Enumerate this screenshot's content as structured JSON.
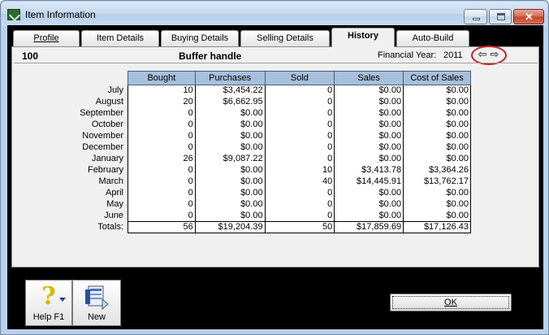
{
  "window": {
    "title": "Item Information"
  },
  "tabs": [
    {
      "label": "Profile"
    },
    {
      "label": "Item Details"
    },
    {
      "label": "Buying Details"
    },
    {
      "label": "Selling Details"
    },
    {
      "label": "History"
    },
    {
      "label": "Auto-Build"
    }
  ],
  "active_tab": "History",
  "item": {
    "number": "100",
    "name": "Buffer handle"
  },
  "financial_year": {
    "label": "Financial Year:",
    "value": "2011"
  },
  "history": {
    "columns": [
      "Bought",
      "Purchases",
      "Sold",
      "Sales",
      "Cost of Sales"
    ],
    "rows": [
      {
        "month": "July",
        "bought": "10",
        "purchases": "$3,454.22",
        "sold": "0",
        "sales": "$0.00",
        "cost": "$0.00"
      },
      {
        "month": "August",
        "bought": "20",
        "purchases": "$6,662.95",
        "sold": "0",
        "sales": "$0.00",
        "cost": "$0.00"
      },
      {
        "month": "September",
        "bought": "0",
        "purchases": "$0.00",
        "sold": "0",
        "sales": "$0.00",
        "cost": "$0.00"
      },
      {
        "month": "October",
        "bought": "0",
        "purchases": "$0.00",
        "sold": "0",
        "sales": "$0.00",
        "cost": "$0.00"
      },
      {
        "month": "November",
        "bought": "0",
        "purchases": "$0.00",
        "sold": "0",
        "sales": "$0.00",
        "cost": "$0.00"
      },
      {
        "month": "December",
        "bought": "0",
        "purchases": "$0.00",
        "sold": "0",
        "sales": "$0.00",
        "cost": "$0.00"
      },
      {
        "month": "January",
        "bought": "26",
        "purchases": "$9,087.22",
        "sold": "0",
        "sales": "$0.00",
        "cost": "$0.00"
      },
      {
        "month": "February",
        "bought": "0",
        "purchases": "$0.00",
        "sold": "10",
        "sales": "$3,413.78",
        "cost": "$3,364.26"
      },
      {
        "month": "March",
        "bought": "0",
        "purchases": "$0.00",
        "sold": "40",
        "sales": "$14,445.91",
        "cost": "$13,762.17"
      },
      {
        "month": "April",
        "bought": "0",
        "purchases": "$0.00",
        "sold": "0",
        "sales": "$0.00",
        "cost": "$0.00"
      },
      {
        "month": "May",
        "bought": "0",
        "purchases": "$0.00",
        "sold": "0",
        "sales": "$0.00",
        "cost": "$0.00"
      },
      {
        "month": "June",
        "bought": "0",
        "purchases": "$0.00",
        "sold": "0",
        "sales": "$0.00",
        "cost": "$0.00"
      }
    ],
    "totals": {
      "label": "Totals:",
      "bought": "56",
      "purchases": "$19,204.39",
      "sold": "50",
      "sales": "$17,859.69",
      "cost": "$17,126.43"
    }
  },
  "toolbar": {
    "help_label": "Help F1",
    "new_label": "New"
  },
  "ok_label": "OK",
  "icons": {
    "app": "item-info-icon",
    "help": "help-question-icon",
    "new": "new-item-icon",
    "prev": "arrow-left-icon",
    "next": "arrow-right-icon"
  },
  "colors": {
    "header": "#a6bfdc",
    "highlight_oval": "#c42020",
    "titlebar": "#c5d9ef"
  }
}
